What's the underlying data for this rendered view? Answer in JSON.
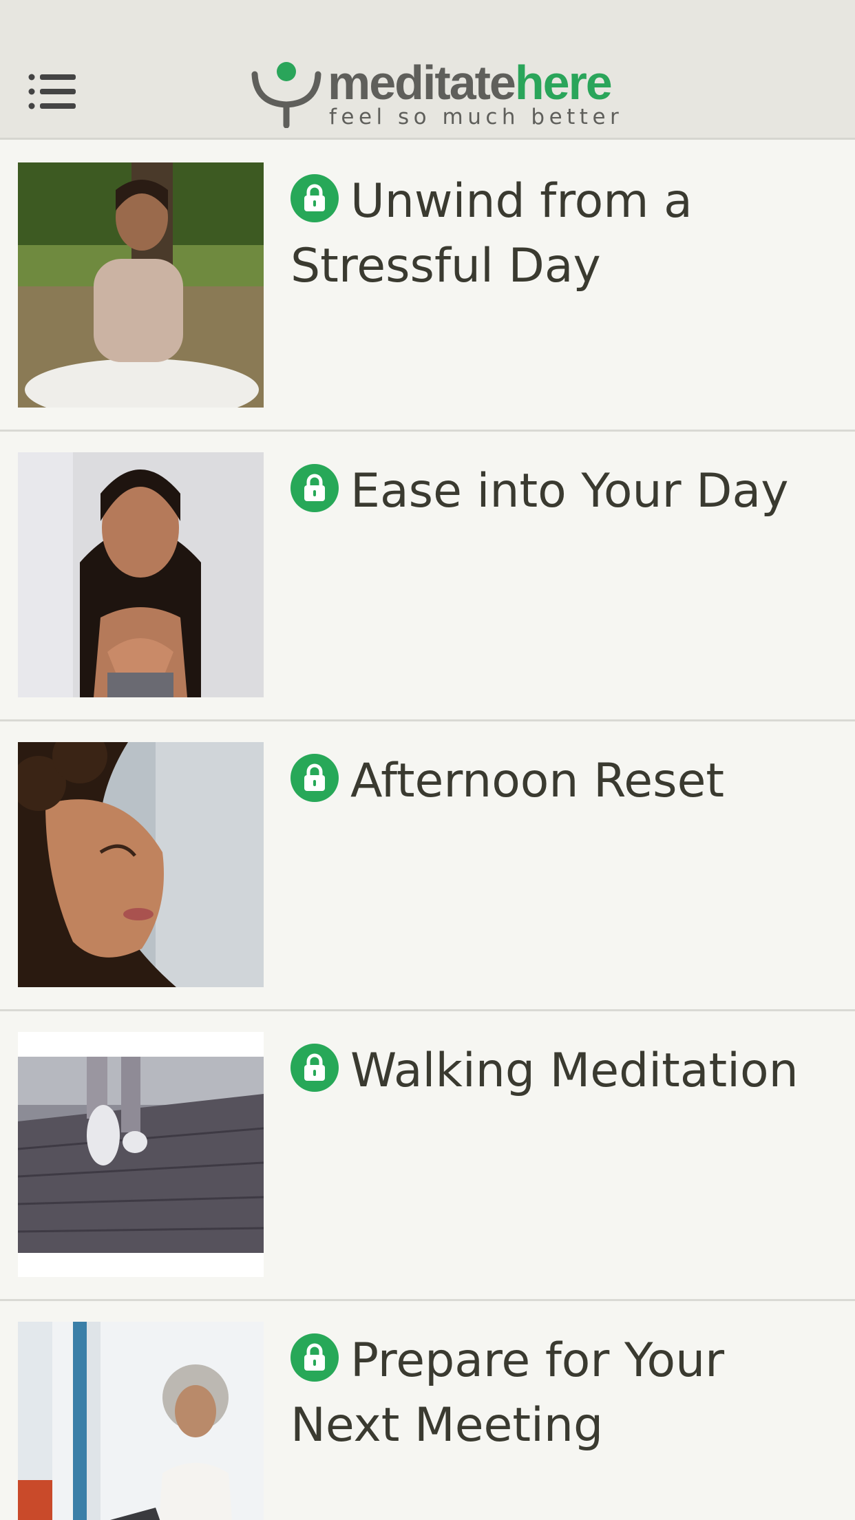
{
  "header": {
    "menu_icon": "list-menu-icon",
    "logo": {
      "word_main": "meditate",
      "word_accent": "here",
      "tagline": "feel so much better",
      "colors": {
        "text": "#5f5f5b",
        "accent": "#2aa55a"
      }
    }
  },
  "lock_color": "#27a858",
  "items": [
    {
      "title": "Unwind from a Stressful Day",
      "locked": true,
      "icon": "lock-icon",
      "image": "woman meditating cross-legged by tree"
    },
    {
      "title": "Ease into Your Day",
      "locked": true,
      "icon": "lock-icon",
      "image": "woman with hands on chest, eyes closed"
    },
    {
      "title": "Afternoon Reset",
      "locked": true,
      "icon": "lock-icon",
      "image": "woman with curly hair, face tilted up, eyes closed"
    },
    {
      "title": "Walking Meditation",
      "locked": true,
      "icon": "lock-icon",
      "image": "feet walking on wooden boardwalk"
    },
    {
      "title": "Prepare for Your Next Meeting",
      "locked": true,
      "icon": "lock-icon",
      "image": "woman at desk with laptop"
    }
  ]
}
